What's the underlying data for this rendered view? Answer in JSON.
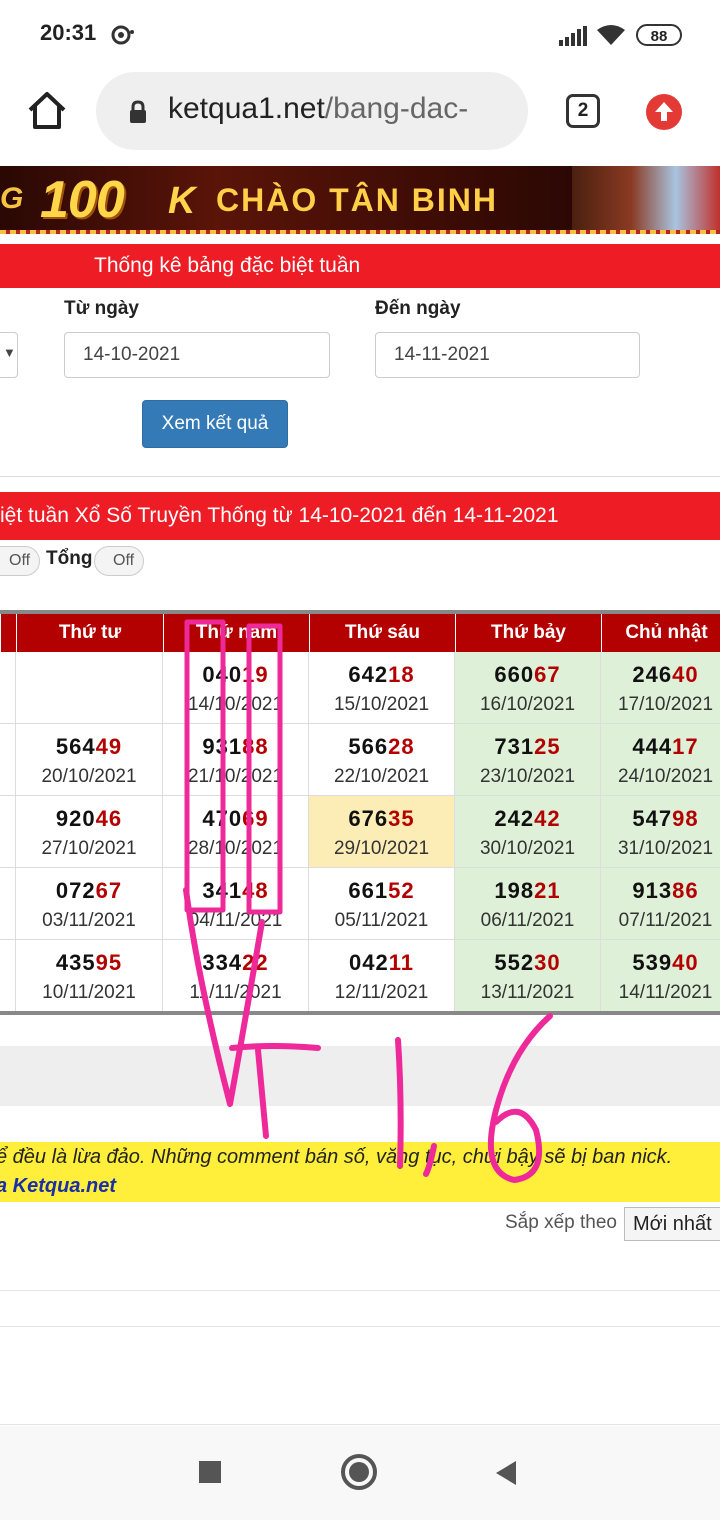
{
  "status_bar": {
    "time": "20:31",
    "battery": "88"
  },
  "browser": {
    "url_host": "ketqua1.net",
    "url_path": "/bang-dac-",
    "tab_count": "2"
  },
  "banner": {
    "prefix": "G",
    "amount": "100",
    "amount_suffix": "K",
    "text": "CHÀO TÂN BINH"
  },
  "header": {
    "title": "Thống kê bảng đặc biệt tuần"
  },
  "form": {
    "from_label": "Từ ngày",
    "from_value": "14-10-2021",
    "to_label": "Đến ngày",
    "to_value": "14-11-2021",
    "submit_label": "Xem kết quả"
  },
  "result_title": "iệt tuần Xổ Số Truyền Thống từ 14-10-2021 đến 14-11-2021",
  "toggles": {
    "first_state": "Off",
    "tong_label": "Tổng",
    "tong_state": "Off"
  },
  "table": {
    "columns": [
      "Thứ tư",
      "Thứ năm",
      "Thứ sáu",
      "Thứ bảy",
      "Chủ nhật"
    ],
    "rows": [
      [
        {
          "head": "",
          "tail": "",
          "date": ""
        },
        {
          "head": "040",
          "tail": "19",
          "date": "14/10/2021"
        },
        {
          "head": "642",
          "tail": "18",
          "date": "15/10/2021"
        },
        {
          "head": "660",
          "tail": "67",
          "date": "16/10/2021"
        },
        {
          "head": "246",
          "tail": "40",
          "date": "17/10/2021"
        }
      ],
      [
        {
          "head": "564",
          "tail": "49",
          "date": "20/10/2021"
        },
        {
          "head": "931",
          "tail": "88",
          "date": "21/10/2021"
        },
        {
          "head": "566",
          "tail": "28",
          "date": "22/10/2021"
        },
        {
          "head": "731",
          "tail": "25",
          "date": "23/10/2021"
        },
        {
          "head": "444",
          "tail": "17",
          "date": "24/10/2021"
        }
      ],
      [
        {
          "head": "920",
          "tail": "46",
          "date": "27/10/2021"
        },
        {
          "head": "470",
          "tail": "69",
          "date": "28/10/2021"
        },
        {
          "head": "676",
          "tail": "35",
          "date": "29/10/2021"
        },
        {
          "head": "242",
          "tail": "42",
          "date": "30/10/2021"
        },
        {
          "head": "547",
          "tail": "98",
          "date": "31/10/2021"
        }
      ],
      [
        {
          "head": "072",
          "tail": "67",
          "date": "03/11/2021"
        },
        {
          "head": "341",
          "tail": "48",
          "date": "04/11/2021"
        },
        {
          "head": "661",
          "tail": "52",
          "date": "05/11/2021"
        },
        {
          "head": "198",
          "tail": "21",
          "date": "06/11/2021"
        },
        {
          "head": "913",
          "tail": "86",
          "date": "07/11/2021"
        }
      ],
      [
        {
          "head": "435",
          "tail": "95",
          "date": "10/11/2021"
        },
        {
          "head": "334",
          "tail": "22",
          "date": "11/11/2021"
        },
        {
          "head": "042",
          "tail": "11",
          "date": "12/11/2021"
        },
        {
          "head": "552",
          "tail": "30",
          "date": "13/11/2021"
        },
        {
          "head": "539",
          "tail": "40",
          "date": "14/11/2021"
        }
      ]
    ],
    "highlight": {
      "yellow_cell": "29/10/2021",
      "green_columns": [
        "Thứ bảy",
        "Chủ nhật"
      ]
    }
  },
  "notice": {
    "line1": "ể đều là lừa đảo. Những comment bán số, văng tục, chửi bậy sẽ bị ban nick.",
    "line2": "a Ketqua.net"
  },
  "comments": {
    "sort_label": "Sắp xếp theo",
    "sort_value": "Mới nhất"
  },
  "handwriting": {
    "text": "VT 1,6",
    "color": "#ee2a9a"
  },
  "colors": {
    "red_bar": "#ee1c25",
    "header_red": "#b30000",
    "button_blue": "#337ab7",
    "notice_yellow": "#ffef3b",
    "weekend_green": "#dff0d8"
  },
  "icons": [
    "notification-icon",
    "signal-icon",
    "wifi-icon",
    "battery-icon",
    "home-icon",
    "lock-icon",
    "tabs-icon",
    "update-icon",
    "stop-icon",
    "home-circle-icon",
    "back-icon"
  ]
}
